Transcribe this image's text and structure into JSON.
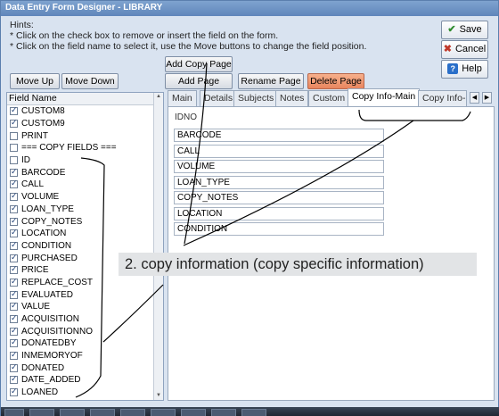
{
  "window": {
    "title": "Data Entry Form Designer - LIBRARY"
  },
  "hints": {
    "title": "Hints:",
    "line1": "* Click on the check box to remove or insert the field on the form.",
    "line2": "* Click on the field name to select it, use the Move buttons to change the field position."
  },
  "buttons": {
    "move_up": "Move Up",
    "move_down": "Move Down",
    "add_copy_page": "Add Copy Page",
    "add_page": "Add Page",
    "rename_page": "Rename Page",
    "delete_page": "Delete Page",
    "save": "Save",
    "cancel": "Cancel",
    "help": "Help"
  },
  "field_list": {
    "header": "Field Name",
    "rows": [
      {
        "label": "CUSTOM8",
        "checked": true
      },
      {
        "label": "CUSTOM9",
        "checked": true
      },
      {
        "label": "PRINT",
        "checked": false
      },
      {
        "label": "=== COPY FIELDS ===",
        "checked": false
      },
      {
        "label": "ID",
        "checked": false
      },
      {
        "label": "BARCODE",
        "checked": true
      },
      {
        "label": "CALL",
        "checked": true
      },
      {
        "label": "VOLUME",
        "checked": true
      },
      {
        "label": "LOAN_TYPE",
        "checked": true
      },
      {
        "label": "COPY_NOTES",
        "checked": true
      },
      {
        "label": "LOCATION",
        "checked": true
      },
      {
        "label": "CONDITION",
        "checked": true
      },
      {
        "label": "PURCHASED",
        "checked": true
      },
      {
        "label": "PRICE",
        "checked": true
      },
      {
        "label": "REPLACE_COST",
        "checked": true
      },
      {
        "label": "EVALUATED",
        "checked": true
      },
      {
        "label": "VALUE",
        "checked": true
      },
      {
        "label": "ACQUISITION",
        "checked": true
      },
      {
        "label": "ACQUISITIONNO",
        "checked": true
      },
      {
        "label": "DONATEDBY",
        "checked": true
      },
      {
        "label": "INMEMORYOF",
        "checked": true
      },
      {
        "label": "DONATED",
        "checked": true
      },
      {
        "label": "DATE_ADDED",
        "checked": true
      },
      {
        "label": "LOANED",
        "checked": true
      }
    ]
  },
  "tabs": [
    "Main",
    "Details",
    "Subjects",
    "Notes",
    "Custom",
    "Copy Info-Main",
    "Copy Info-"
  ],
  "active_tab": "Copy Info-Main",
  "form": {
    "idno": "IDNO",
    "fields": [
      "BARCODE",
      "CALL",
      "VOLUME",
      "LOAN_TYPE",
      "COPY_NOTES",
      "LOCATION",
      "CONDITION"
    ]
  },
  "annotation": {
    "caption": "2. copy information (copy specific information)"
  },
  "icons": {
    "save": "check-icon",
    "cancel": "x-icon",
    "help": "question-icon",
    "tab_prev": "chevron-left-icon",
    "tab_next": "chevron-right-icon"
  },
  "colors": {
    "delete_button": "#e8855e",
    "titlebar": "#5f86bb"
  }
}
